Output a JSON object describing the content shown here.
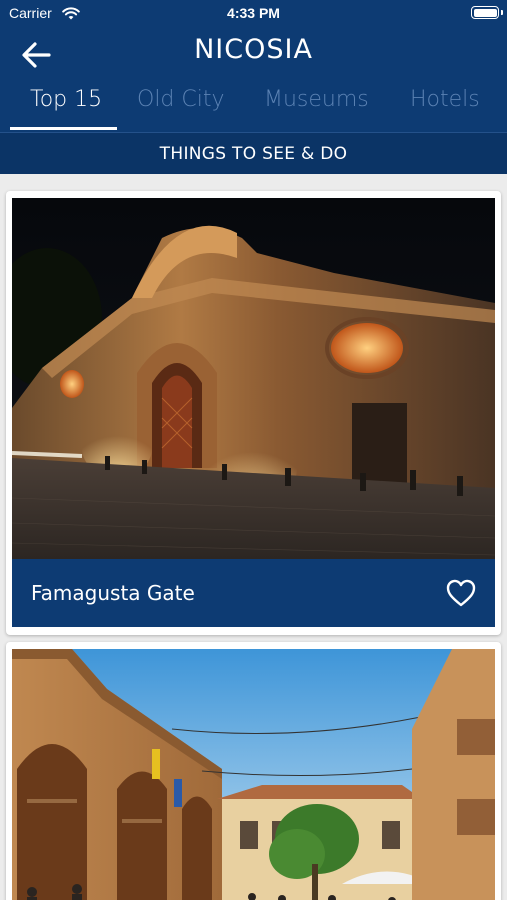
{
  "status_bar": {
    "carrier": "Carrier",
    "time": "4:33 PM"
  },
  "header": {
    "title": "NICOSIA",
    "back_icon": "arrow-left-icon"
  },
  "tabs": [
    {
      "label": "Top 15",
      "active": true
    },
    {
      "label": "Old City",
      "active": false
    },
    {
      "label": "Museums",
      "active": false
    },
    {
      "label": "Hotels",
      "active": false
    }
  ],
  "section": {
    "title": "THINGS TO SEE & DO"
  },
  "places": [
    {
      "name": "Famagusta Gate",
      "favorite_icon": "heart-outline-icon"
    },
    {
      "name": ""
    }
  ],
  "colors": {
    "primary": "#0d3b73",
    "tab_inactive": "#5b82b3",
    "background": "#ececec"
  }
}
